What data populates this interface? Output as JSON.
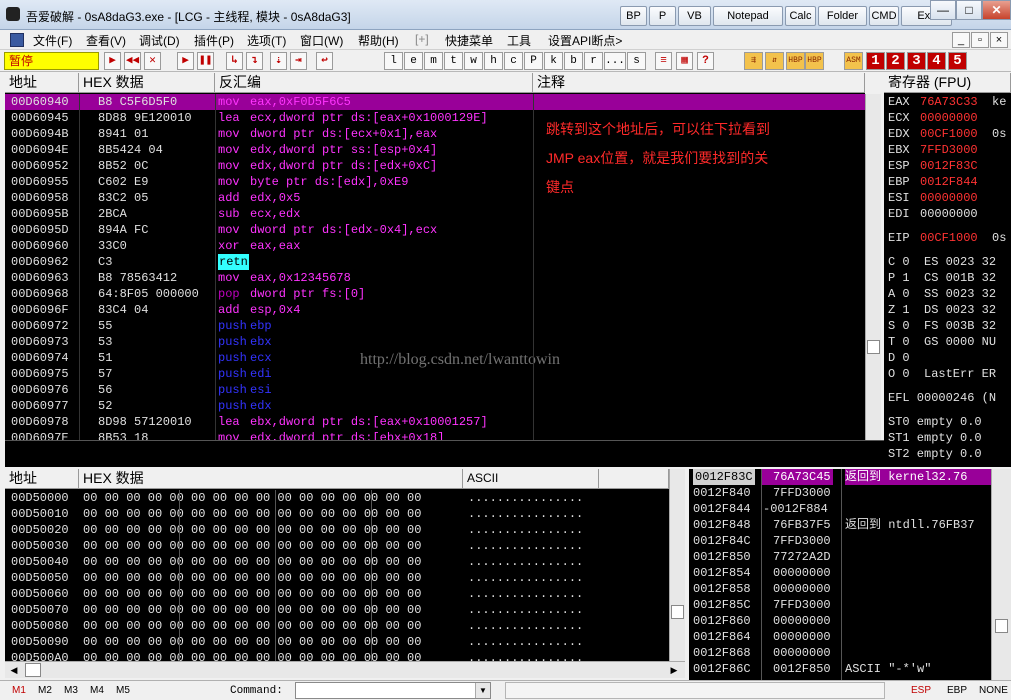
{
  "window": {
    "title": "吾爱破解 - 0sA8daG3.exe - [LCG - 主线程, 模块 - 0sA8daG3]",
    "quick_buttons": [
      "BP",
      "P",
      "VB",
      "Notepad",
      "Calc",
      "Folder",
      "CMD",
      "Exit"
    ],
    "controls": {
      "minimize": "—",
      "maximize": "□",
      "close": "✕"
    }
  },
  "menu": {
    "items": [
      "文件(F)",
      "查看(V)",
      "调试(D)",
      "插件(P)",
      "选项(T)",
      "窗口(W)",
      "帮助(H)",
      "[+]",
      "快捷菜单",
      "工具",
      "设置API断点>"
    ],
    "mdi": {
      "minimize": "_",
      "restore": "▫",
      "close": "×"
    }
  },
  "toolbar": {
    "status": "暂停",
    "controls": [
      "▶",
      "◀◀",
      "✕",
      "▶",
      "❚❚",
      "↳",
      "↴",
      "⇣",
      "⇥",
      "↩"
    ],
    "letters": [
      "l",
      "e",
      "m",
      "t",
      "w",
      "h",
      "c",
      "P",
      "k",
      "b",
      "r",
      "...",
      "s"
    ],
    "extra": [
      "≡",
      "▦",
      "?"
    ],
    "right_orange": [
      "⇶",
      "⇵",
      "HBP",
      "HBP",
      "ASM"
    ],
    "numbers": [
      "1",
      "2",
      "3",
      "4",
      "5"
    ]
  },
  "disasm": {
    "headers": {
      "addr": "地址",
      "hex": "HEX 数据",
      "disasm": "反汇编",
      "comment": "注释"
    },
    "rows": [
      {
        "addr": "00D60940",
        "hex": "B8 C5F6D5F0",
        "mn": "mov",
        "ops": "eax,0xF0D5F6C5",
        "selected": true
      },
      {
        "addr": "00D60945",
        "hex": "8D88 9E120010",
        "mn": "lea",
        "ops": "ecx,dword ptr ds:[eax+0x1000129E]"
      },
      {
        "addr": "00D6094B",
        "hex": "8941 01",
        "mn": "mov",
        "ops": "dword ptr ds:[ecx+0x1],eax"
      },
      {
        "addr": "00D6094E",
        "hex": "8B5424 04",
        "mn": "mov",
        "ops": "edx,dword ptr ss:[esp+0x4]"
      },
      {
        "addr": "00D60952",
        "hex": "8B52 0C",
        "mn": "mov",
        "ops": "edx,dword ptr ds:[edx+0xC]"
      },
      {
        "addr": "00D60955",
        "hex": "C602 E9",
        "mn": "mov",
        "ops": "byte ptr ds:[edx],0xE9"
      },
      {
        "addr": "00D60958",
        "hex": "83C2 05",
        "mn": "add",
        "ops": "edx,0x5"
      },
      {
        "addr": "00D6095B",
        "hex": "2BCA",
        "mn": "sub",
        "ops": "ecx,edx"
      },
      {
        "addr": "00D6095D",
        "hex": "894A FC",
        "mn": "mov",
        "ops": "dword ptr ds:[edx-0x4],ecx"
      },
      {
        "addr": "00D60960",
        "hex": "33C0",
        "mn": "xor",
        "ops": "eax,eax"
      },
      {
        "addr": "00D60962",
        "hex": "C3",
        "mn": "retn",
        "ops": "",
        "ret": true
      },
      {
        "addr": "00D60963",
        "hex": "B8 78563412",
        "mn": "mov",
        "ops": "eax,0x12345678"
      },
      {
        "addr": "00D60968",
        "hex": "64:8F05 000000",
        "mn": "pop",
        "ops": "dword ptr fs:[0]",
        "orange": true
      },
      {
        "addr": "00D6096F",
        "hex": "83C4 04",
        "mn": "add",
        "ops": "esp,0x4"
      },
      {
        "addr": "00D60972",
        "hex": "55",
        "mn": "push",
        "ops": "ebp",
        "push": true
      },
      {
        "addr": "00D60973",
        "hex": "53",
        "mn": "push",
        "ops": "ebx",
        "push": true
      },
      {
        "addr": "00D60974",
        "hex": "51",
        "mn": "push",
        "ops": "ecx",
        "push": true
      },
      {
        "addr": "00D60975",
        "hex": "57",
        "mn": "push",
        "ops": "edi",
        "push": true
      },
      {
        "addr": "00D60976",
        "hex": "56",
        "mn": "push",
        "ops": "esi",
        "push": true
      },
      {
        "addr": "00D60977",
        "hex": "52",
        "mn": "push",
        "ops": "edx",
        "push": true
      },
      {
        "addr": "00D60978",
        "hex": "8D98 57120010",
        "mn": "lea",
        "ops": "ebx,dword ptr ds:[eax+0x10001257]"
      },
      {
        "addr": "00D6097E",
        "hex": "8B53 18",
        "mn": "mov",
        "ops": "edx,dword ptr ds:[ebx+0x18]"
      }
    ],
    "comment_note": [
      "跳转到这个地址后，可以往下拉看到",
      "JMP eax位置，就是我们要找到的关",
      "键点"
    ],
    "watermark": "http://blog.csdn.net/lwanttowin"
  },
  "registers": {
    "header": "寄存器 (FPU)",
    "general": [
      {
        "name": "EAX",
        "value": "76A73C33",
        "extra": "ke",
        "red": true
      },
      {
        "name": "ECX",
        "value": "00000000",
        "extra": "",
        "red": true
      },
      {
        "name": "EDX",
        "value": "00CF1000",
        "extra": "0s",
        "red": true
      },
      {
        "name": "EBX",
        "value": "7FFD3000",
        "extra": "",
        "red": true
      },
      {
        "name": "ESP",
        "value": "0012F83C",
        "extra": "",
        "red": true
      },
      {
        "name": "EBP",
        "value": "0012F844",
        "extra": "",
        "red": true
      },
      {
        "name": "ESI",
        "value": "00000000",
        "extra": "",
        "red": true
      },
      {
        "name": "EDI",
        "value": "00000000",
        "extra": "",
        "red": false
      }
    ],
    "eip": {
      "name": "EIP",
      "value": "00CF1000",
      "extra": "0s"
    },
    "flags": [
      "C 0  ES 0023 32",
      "P 1  CS 001B 32",
      "A 0  SS 0023 32",
      "Z 1  DS 0023 32",
      "S 0  FS 003B 32",
      "T 0  GS 0000 NU",
      "D 0",
      "O 0  LastErr ER"
    ],
    "efl": "EFL 00000246 (N",
    "fpu": [
      "ST0 empty 0.0",
      "ST1 empty 0.0",
      "ST2 empty 0.0"
    ]
  },
  "dump": {
    "headers": {
      "addr": "地址",
      "hex": "HEX 数据",
      "ascii": "ASCII"
    },
    "rows": [
      {
        "addr": "00D50000",
        "hex": "00 00 00 00 00 00 00 00 00 00 00 00 00 00 00 00",
        "ascii": "................"
      },
      {
        "addr": "00D50010",
        "hex": "00 00 00 00 00 00 00 00 00 00 00 00 00 00 00 00",
        "ascii": "................"
      },
      {
        "addr": "00D50020",
        "hex": "00 00 00 00 00 00 00 00 00 00 00 00 00 00 00 00",
        "ascii": "................"
      },
      {
        "addr": "00D50030",
        "hex": "00 00 00 00 00 00 00 00 00 00 00 00 00 00 00 00",
        "ascii": "................"
      },
      {
        "addr": "00D50040",
        "hex": "00 00 00 00 00 00 00 00 00 00 00 00 00 00 00 00",
        "ascii": "................"
      },
      {
        "addr": "00D50050",
        "hex": "00 00 00 00 00 00 00 00 00 00 00 00 00 00 00 00",
        "ascii": "................"
      },
      {
        "addr": "00D50060",
        "hex": "00 00 00 00 00 00 00 00 00 00 00 00 00 00 00 00",
        "ascii": "................"
      },
      {
        "addr": "00D50070",
        "hex": "00 00 00 00 00 00 00 00 00 00 00 00 00 00 00 00",
        "ascii": "................"
      },
      {
        "addr": "00D50080",
        "hex": "00 00 00 00 00 00 00 00 00 00 00 00 00 00 00 00",
        "ascii": "................"
      },
      {
        "addr": "00D50090",
        "hex": "00 00 00 00 00 00 00 00 00 00 00 00 00 00 00 00",
        "ascii": "................"
      },
      {
        "addr": "00D500A0",
        "hex": "00 00 00 00 00 00 00 00 00 00 00 00 00 00 00 00",
        "ascii": "................"
      }
    ]
  },
  "stack": {
    "rows": [
      {
        "addr": "0012F83C",
        "value": "76A73C45",
        "comment": "返回到 kernel32.76",
        "selected": true
      },
      {
        "addr": "0012F840",
        "value": "7FFD3000",
        "comment": ""
      },
      {
        "addr": "0012F844",
        "value": "-0012F884",
        "comment": ""
      },
      {
        "addr": "0012F848",
        "value": "76FB37F5",
        "comment": "返回到 ntdll.76FB37"
      },
      {
        "addr": "0012F84C",
        "value": "7FFD3000",
        "comment": ""
      },
      {
        "addr": "0012F850",
        "value": "77272A2D",
        "comment": ""
      },
      {
        "addr": "0012F854",
        "value": "00000000",
        "comment": ""
      },
      {
        "addr": "0012F858",
        "value": "00000000",
        "comment": ""
      },
      {
        "addr": "0012F85C",
        "value": "7FFD3000",
        "comment": ""
      },
      {
        "addr": "0012F860",
        "value": "00000000",
        "comment": ""
      },
      {
        "addr": "0012F864",
        "value": "00000000",
        "comment": ""
      },
      {
        "addr": "0012F868",
        "value": "00000000",
        "comment": ""
      },
      {
        "addr": "0012F86C",
        "value": "0012F850",
        "comment": "ASCII \"-*'w\""
      }
    ]
  },
  "statusbar": {
    "tabs": [
      "M1",
      "M2",
      "M3",
      "M4",
      "M5"
    ],
    "command_label": "Command:",
    "command_value": "",
    "right": [
      "ESP",
      "EBP",
      "NONE"
    ]
  },
  "colors": {
    "selection": "#990099",
    "register_changed": "#ff3333",
    "mnemonic": "#ff33ff",
    "push": "#3333ff",
    "retn_bg": "#33ffff"
  }
}
